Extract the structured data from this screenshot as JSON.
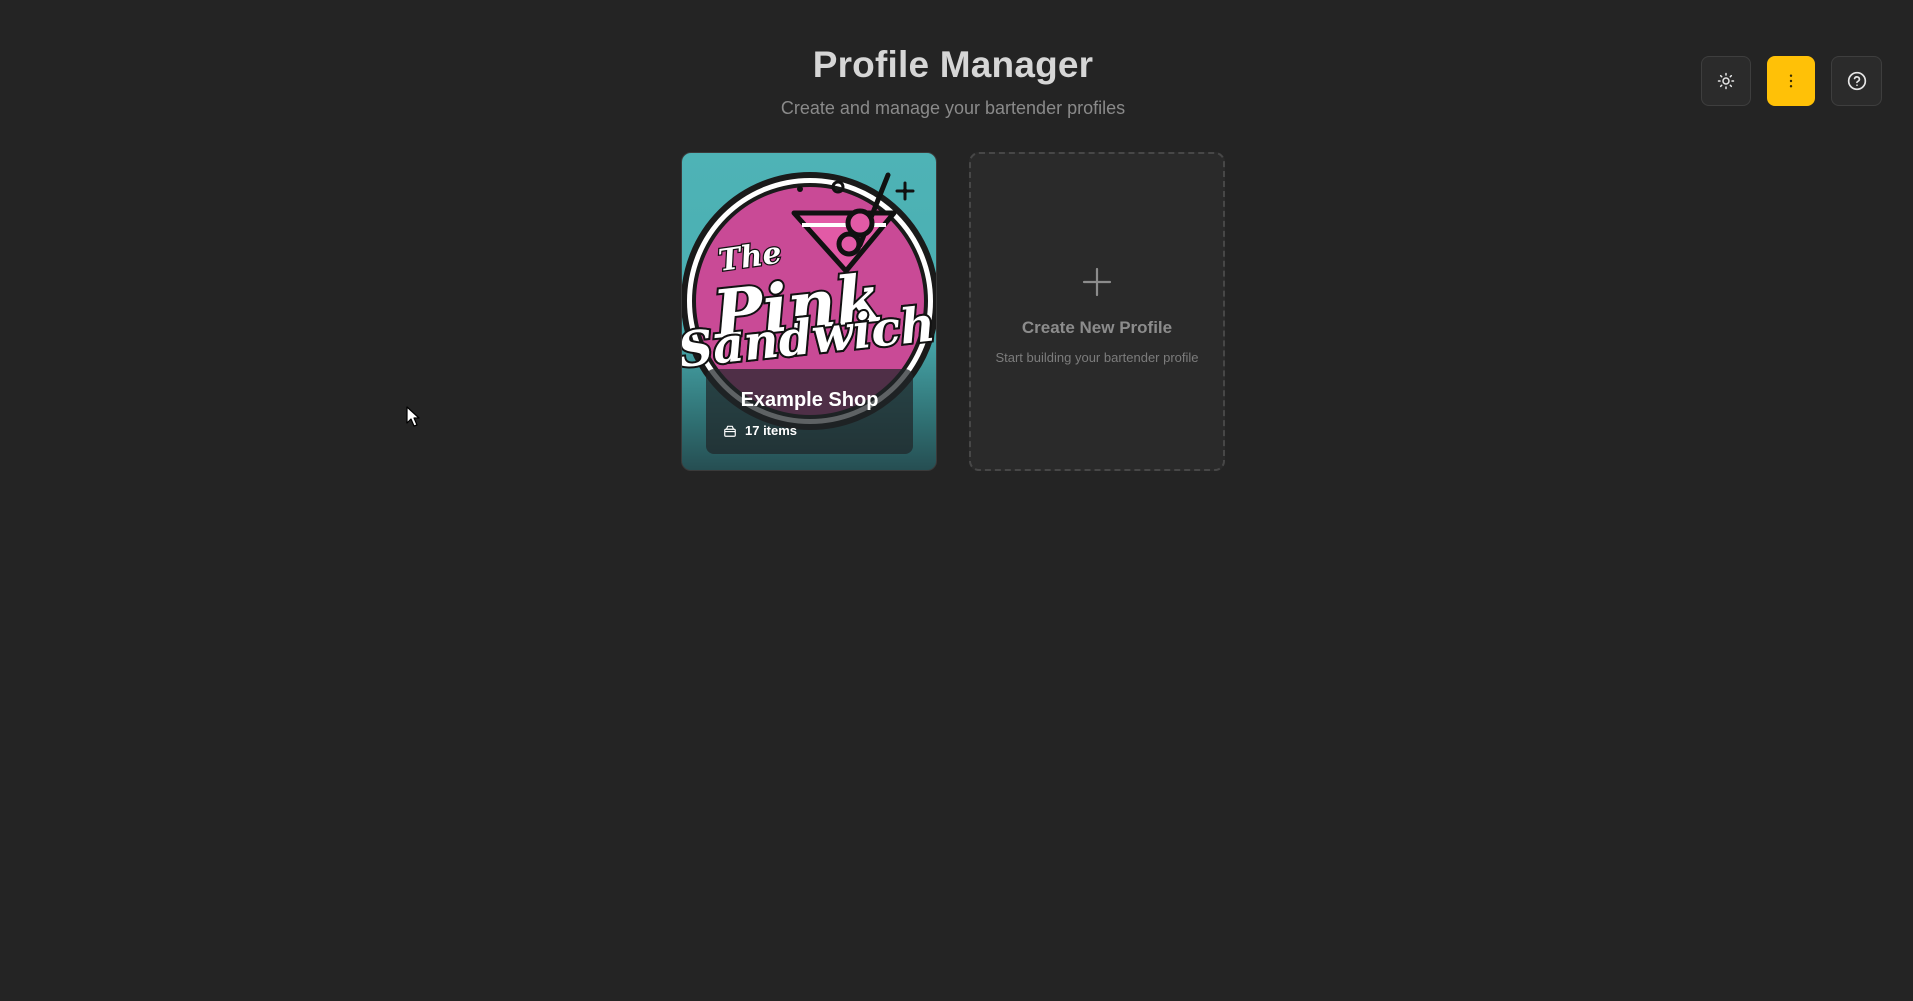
{
  "header": {
    "title": "Profile Manager",
    "subtitle": "Create and manage your bartender profiles"
  },
  "toolbar": {
    "theme_icon": "sun-icon",
    "menu_icon": "vertical-dots-icon",
    "help_icon": "help-circle-icon",
    "menu_accent": "#ffc107"
  },
  "profiles": [
    {
      "name": "Example Shop",
      "item_count": "17 items",
      "count_icon": "box-icon",
      "logo": {
        "line1": "The",
        "line2": "Pink",
        "line3": "Sandwich",
        "circle_color": "#c94a96",
        "background_color": "#4eb3b6"
      }
    }
  ],
  "create_card": {
    "icon": "plus-icon",
    "title": "Create New Profile",
    "subtitle": "Start building your bartender profile"
  }
}
